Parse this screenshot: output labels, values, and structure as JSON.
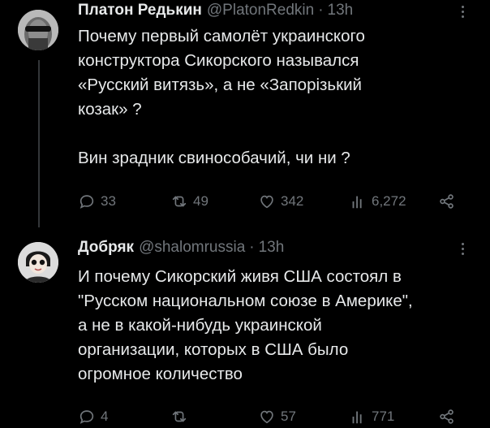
{
  "tweets": [
    {
      "display_name": "Платон Редькин",
      "handle": "@PlatonRedkin",
      "separator": "·",
      "time": "13h",
      "text_lines": [
        "Почему первый самолёт  украинского",
        "конструктора Сикорского назывался",
        "«Русский витязь», а не «Запорізький",
        "козак» ?",
        "",
        "Вин зрадник свинособачий, чи ни ?"
      ],
      "stats": {
        "replies": "33",
        "reposts": "49",
        "likes": "342",
        "views": "6,272"
      }
    },
    {
      "display_name": "Добряк",
      "handle": "@shalomrussia",
      "separator": "·",
      "time": "13h",
      "text_lines": [
        "И почему Сикорский живя США состоял в",
        "\"Русском национальном союзе в Америке\",",
        "а не в какой-нибудь украинской",
        "организации, которых в США было",
        "огромное количество"
      ],
      "stats": {
        "replies": "4",
        "reposts": "",
        "likes": "57",
        "views": "771"
      }
    }
  ],
  "icons": {
    "reply": "speech-bubble-icon",
    "repost": "repost-arrows-icon",
    "like": "heart-icon",
    "views": "bar-chart-icon",
    "share": "share-nodes-icon",
    "more": "more-dots-icon"
  },
  "colors": {
    "background": "#000000",
    "text": "#e7e9ea",
    "muted": "#71767b",
    "divider": "#333639"
  }
}
